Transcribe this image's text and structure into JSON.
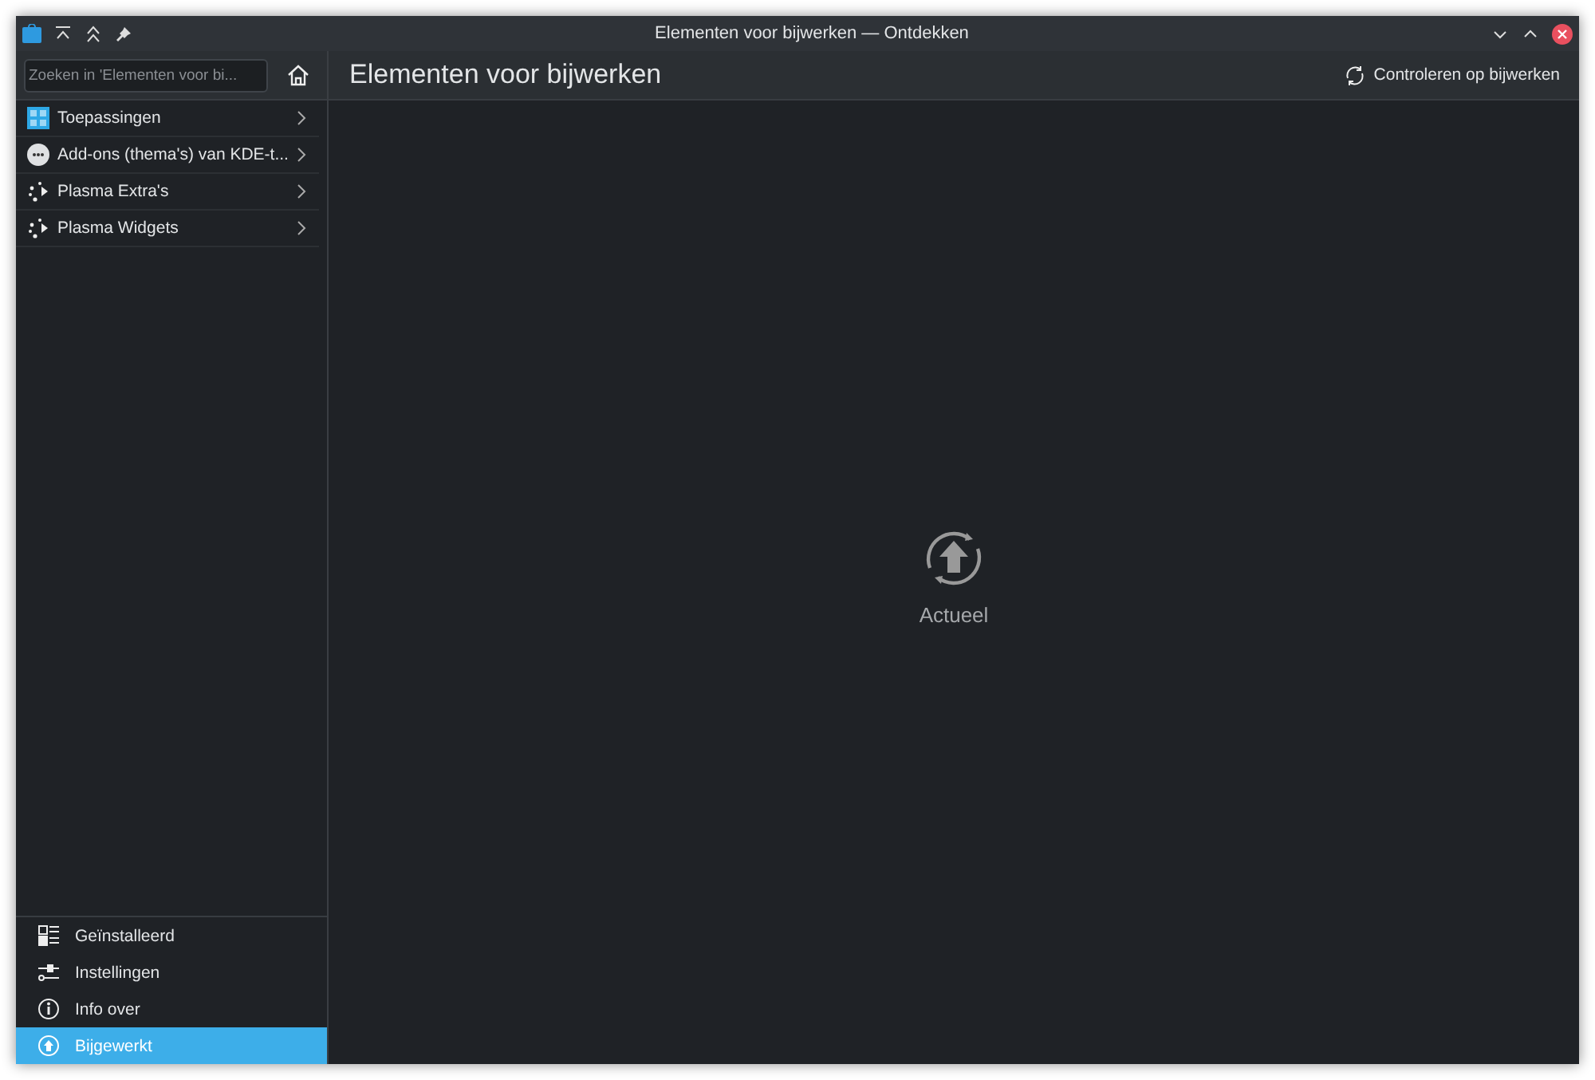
{
  "window": {
    "title": "Elementen voor bijwerken — Ontdekken"
  },
  "search": {
    "placeholder": "Zoeken in 'Elementen voor bi..."
  },
  "categories": [
    {
      "label": "Toepassingen",
      "kind": "apps"
    },
    {
      "label": "Add-ons (thema's) van KDE-t...",
      "kind": "addons"
    },
    {
      "label": "Plasma Extra's",
      "kind": "plasma"
    },
    {
      "label": "Plasma Widgets",
      "kind": "plasma"
    }
  ],
  "nav": [
    {
      "label": "Geïnstalleerd",
      "kind": "installed",
      "selected": false
    },
    {
      "label": "Instellingen",
      "kind": "settings",
      "selected": false
    },
    {
      "label": "Info over",
      "kind": "info",
      "selected": false
    },
    {
      "label": "Bijgewerkt",
      "kind": "update",
      "selected": true
    }
  ],
  "page": {
    "title": "Elementen voor bijwerken",
    "action": "Controleren op bijwerken",
    "status": "Actueel"
  }
}
